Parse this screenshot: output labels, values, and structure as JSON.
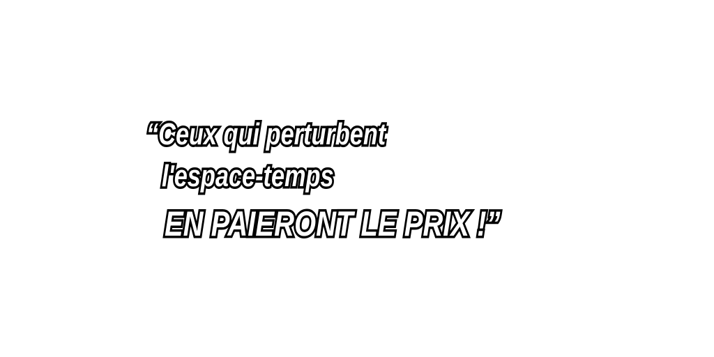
{
  "quote": {
    "line1": "“Ceux qui perturbent",
    "line2": "l'espace-temps",
    "line3": "EN PAIERONT LE PRIX !”"
  },
  "colors": {
    "background": "#ffffff",
    "text_fill": "#ffffff",
    "text_outline": "#000000"
  }
}
